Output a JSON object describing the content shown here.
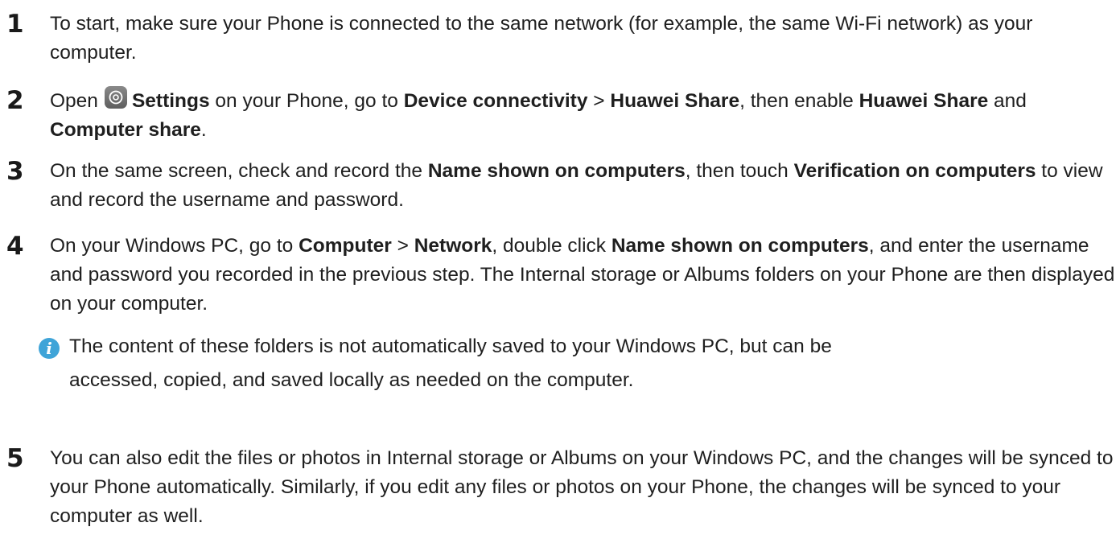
{
  "steps": [
    {
      "number": "1",
      "segments": [
        {
          "t": "To start, make sure your Phone is connected to the same network (for example, the same Wi-Fi network) as your computer.",
          "b": false
        }
      ]
    },
    {
      "number": "2",
      "segments_before_icon": [
        {
          "t": "Open",
          "b": false
        }
      ],
      "segments": [
        {
          "t": "Settings",
          "b": true
        },
        {
          "t": " on your Phone, go to ",
          "b": false
        },
        {
          "t": "Device connectivity",
          "b": true
        },
        {
          "t": " > ",
          "b": false
        },
        {
          "t": "Huawei Share",
          "b": true
        },
        {
          "t": ", then enable ",
          "b": false
        },
        {
          "t": "Huawei Share",
          "b": true
        },
        {
          "t": " and ",
          "b": false
        },
        {
          "t": "Computer share",
          "b": true
        },
        {
          "t": ".",
          "b": false
        }
      ],
      "icon": "settings-gear-icon"
    },
    {
      "number": "3",
      "segments": [
        {
          "t": "On the same screen, check and record the ",
          "b": false
        },
        {
          "t": "Name shown on computers",
          "b": true
        },
        {
          "t": ", then touch ",
          "b": false
        },
        {
          "t": "Verification on computers",
          "b": true
        },
        {
          "t": " to view and record the username and password.",
          "b": false
        }
      ]
    },
    {
      "number": "4",
      "segments": [
        {
          "t": "On your Windows PC, go to ",
          "b": false
        },
        {
          "t": "Computer",
          "b": true
        },
        {
          "t": " > ",
          "b": false
        },
        {
          "t": "Network",
          "b": true
        },
        {
          "t": ", double click ",
          "b": false
        },
        {
          "t": "Name shown on computers",
          "b": true
        },
        {
          "t": ", and enter the username and password you recorded in the previous step. The Internal storage or Albums folders on your Phone are then displayed on your computer.",
          "b": false
        }
      ]
    },
    {
      "number": "5",
      "segments": [
        {
          "t": "You can also edit the files or photos in Internal storage or Albums on your Windows PC, and the changes will be synced to your Phone automatically. Similarly, if you edit any files or photos on your Phone, the changes will be synced to your computer as well.",
          "b": false
        }
      ]
    }
  ],
  "note": {
    "icon": "info-icon",
    "icon_glyph": "i",
    "line1": "The content of these folders is not automatically saved to your Windows PC, but can be",
    "line2": "accessed, copied, and saved locally as needed on the computer.",
    "icon_color": "#3fa4d8"
  }
}
